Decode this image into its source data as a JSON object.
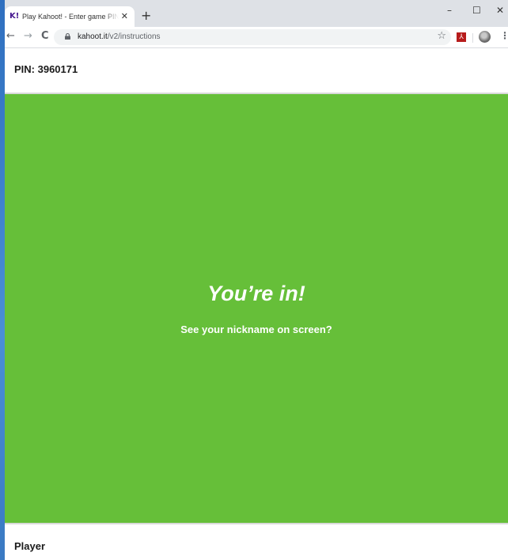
{
  "browser": {
    "tab": {
      "favicon": "K!",
      "title": "Play Kahoot! - Enter game PIN here!",
      "close": "✕"
    },
    "new_tab": "+",
    "window_controls": {
      "minimize": "–",
      "maximize": "☐",
      "close": "✕"
    },
    "nav": {
      "back": "←",
      "forward": "→",
      "reload": "C"
    },
    "url": {
      "domain": "kahoot.it",
      "path": "/v2/instructions"
    },
    "icons": [
      "lock-icon",
      "star-icon",
      "pdf-extension-icon",
      "profile-avatar",
      "menu-icon"
    ]
  },
  "page": {
    "pin": "PIN: 3960171",
    "headline": "You’re in!",
    "subline": "See your nickname on screen?",
    "player_label": "Player",
    "colors": {
      "green": "#66bf39",
      "text": "#1a1a1a",
      "header_bg": "#ffffff"
    }
  }
}
